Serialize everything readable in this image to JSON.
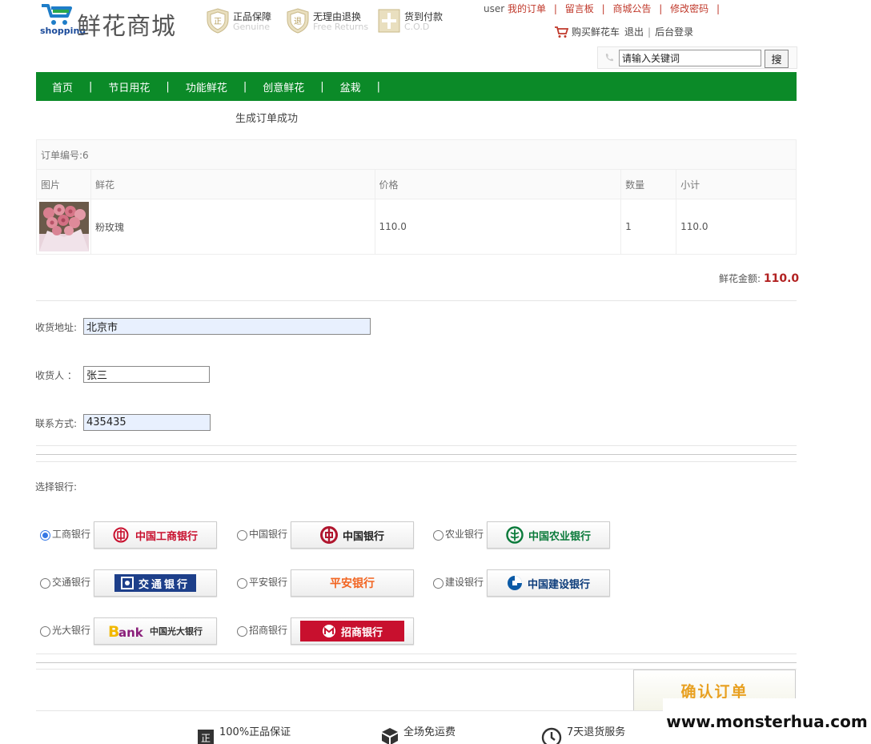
{
  "header": {
    "logo_text": "鲜花商城",
    "logo_sub": "shopping",
    "badges": [
      {
        "cn": "正品保障",
        "en": "Genuine",
        "icon": "genuine-shield-icon"
      },
      {
        "cn": "无理由退换",
        "en": "Free Returns",
        "icon": "returns-shield-icon"
      },
      {
        "cn": "货到付款",
        "en": "C.O.D",
        "icon": "cod-icon"
      }
    ],
    "user": "user",
    "links": [
      "我的订单",
      "留言板",
      "商城公告",
      "修改密码"
    ],
    "cart_link": "购买鲜花车",
    "logout": "退出",
    "admin": "后台登录"
  },
  "search": {
    "placeholder": "请输入关键词",
    "button": "搜"
  },
  "nav": [
    "首页",
    "节日用花",
    "功能鲜花",
    "创意鲜花",
    "盆栽"
  ],
  "order": {
    "success": "生成订单成功",
    "id_label": "订单编号:6",
    "columns": [
      "图片",
      "鲜花",
      "价格",
      "数量",
      "小计"
    ],
    "items": [
      {
        "name": "粉玫瑰",
        "price": "110.0",
        "qty": "1",
        "subtotal": "110.0"
      }
    ],
    "total_label": "鲜花金额:",
    "total": "110.0"
  },
  "form": {
    "address_label": "收货地址:",
    "address": "北京市",
    "receiver_label": "收货人 ：",
    "receiver": "张三",
    "phone_label": "联系方式:",
    "phone": "435435"
  },
  "banks": {
    "label": "选择银行:",
    "selected": "工商银行",
    "items": [
      {
        "name": "工商银行",
        "logo": "中国工商银行"
      },
      {
        "name": "中国银行",
        "logo": "中国银行"
      },
      {
        "name": "农业银行",
        "logo": "中国农业银行"
      },
      {
        "name": "交通银行",
        "logo": "交通银行"
      },
      {
        "name": "平安银行",
        "logo": "平安银行"
      },
      {
        "name": "建设银行",
        "logo": "中国建设银行"
      },
      {
        "name": "光大银行",
        "logo": "中国光大银行"
      },
      {
        "name": "招商银行",
        "logo": "招商银行"
      }
    ]
  },
  "confirm": "确认订单",
  "footer": [
    "100%正品保证",
    "全场免运费",
    "7天退货服务"
  ],
  "watermark": "www.monsterhua.com"
}
